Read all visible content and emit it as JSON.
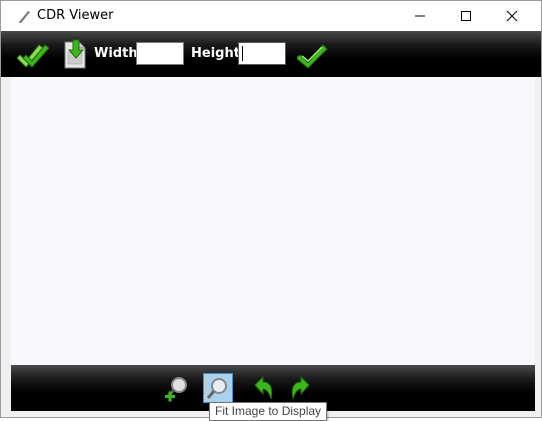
{
  "window": {
    "title": "CDR Viewer"
  },
  "toolbar": {
    "width_label": "Width",
    "height_label": "Height",
    "width_value": "",
    "height_value": ""
  },
  "bottom_toolbar": {
    "buttons": [
      "zoom-in",
      "fit-image",
      "rotate-left",
      "rotate-right"
    ]
  },
  "tooltip": {
    "text": "Fit Image to Display"
  },
  "colors": {
    "toolbar_bg": "#000000",
    "canvas_bg": "#f8f8fc",
    "accent_green": "#3cb81c",
    "active_button": "#a8d2f0"
  }
}
